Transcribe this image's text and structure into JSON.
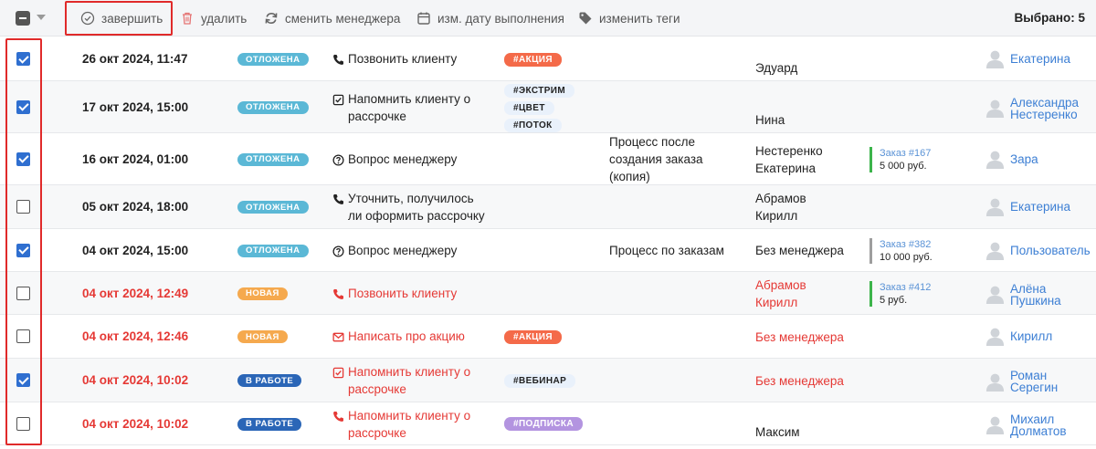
{
  "toolbar": {
    "complete_label": "завершить",
    "delete_label": "удалить",
    "change_manager_label": "сменить менеджера",
    "change_date_label": "изм. дату выполнения",
    "change_tags_label": "изменить теги",
    "selected_count": "Выбрано: 5"
  },
  "colors": {
    "postponed": "#5bb8d6",
    "new": "#f5a94e",
    "in_work": "#2b66b7",
    "accent": "#2f6fd0",
    "urgent": "#e53935"
  },
  "rows": [
    {
      "checked": true,
      "date": "26 окт 2024, 11:47",
      "status": "ОТЛОЖЕНА",
      "task_icon": "phone-icon",
      "task": "Позвонить клиенту",
      "tags": [
        "#АКЦИЯ"
      ],
      "process": "",
      "client": "Эдуард",
      "order_number": "",
      "order_sum": "",
      "manager": "Екатерина"
    },
    {
      "checked": true,
      "date": "17 окт 2024, 15:00",
      "status": "ОТЛОЖЕНА",
      "task_icon": "checkbox-icon",
      "task": "Напомнить клиенту о рассрочке",
      "tags": [
        "#ЭКСТРИМ",
        "#ЦВЕТ",
        "#ПОТОК"
      ],
      "process": "",
      "client": "Нина",
      "order_number": "",
      "order_sum": "",
      "manager": "Александра Нестеренко"
    },
    {
      "checked": true,
      "date": "16 окт 2024, 01:00",
      "status": "ОТЛОЖЕНА",
      "task_icon": "question-icon",
      "task": "Вопрос менеджеру",
      "tags": [],
      "process": "Процесс после создания заказа (копия)",
      "client": "Нестеренко Екатерина",
      "order_number": "Заказ #167",
      "order_sum": "5 000 руб.",
      "manager": "Зара"
    },
    {
      "checked": false,
      "date": "05 окт 2024, 18:00",
      "status": "ОТЛОЖЕНА",
      "task_icon": "phone-icon",
      "task": "Уточнить, получилось ли оформить рассрочку",
      "tags": [],
      "process": "",
      "client": "Абрамов Кирилл",
      "order_number": "",
      "order_sum": "",
      "manager": "Екатерина"
    },
    {
      "checked": true,
      "date": "04 окт 2024, 15:00",
      "status": "ОТЛОЖЕНА",
      "task_icon": "question-icon",
      "task": "Вопрос менеджеру",
      "tags": [],
      "process": "Процесс по заказам",
      "client": "Без менеджера",
      "order_number": "Заказ #382",
      "order_sum": "10 000 руб.",
      "manager": "Пользователь"
    },
    {
      "checked": false,
      "date": "04 окт 2024, 12:49",
      "status": "НОВАЯ",
      "task_icon": "phone-icon",
      "task": "Позвонить клиенту",
      "tags": [],
      "process": "",
      "client": "Абрамов Кирилл",
      "order_number": "Заказ #412",
      "order_sum": "5 руб.",
      "manager": "Алёна Пушкина"
    },
    {
      "checked": false,
      "date": "04 окт 2024, 12:46",
      "status": "НОВАЯ",
      "task_icon": "mail-icon",
      "task": "Написать про акцию",
      "tags": [
        "#АКЦИЯ"
      ],
      "process": "",
      "client": "Без менеджера",
      "order_number": "",
      "order_sum": "",
      "manager": "Кирилл"
    },
    {
      "checked": true,
      "date": "04 окт 2024, 10:02",
      "status": "В РАБОТЕ",
      "task_icon": "checkbox-icon",
      "task": "Напомнить клиенту о рассрочке",
      "tags": [
        "#ВЕБИНАР"
      ],
      "process": "",
      "client": "Без менеджера",
      "order_number": "",
      "order_sum": "",
      "manager": "Роман Серегин"
    },
    {
      "checked": false,
      "date": "04 окт 2024, 10:02",
      "status": "В РАБОТЕ",
      "task_icon": "phone-icon",
      "task": "Напомнить клиенту о рассрочке",
      "tags": [
        "#ПОДПИСКА"
      ],
      "process": "",
      "client": "Максим",
      "order_number": "",
      "order_sum": "",
      "manager": "Михаил Долматов"
    }
  ]
}
